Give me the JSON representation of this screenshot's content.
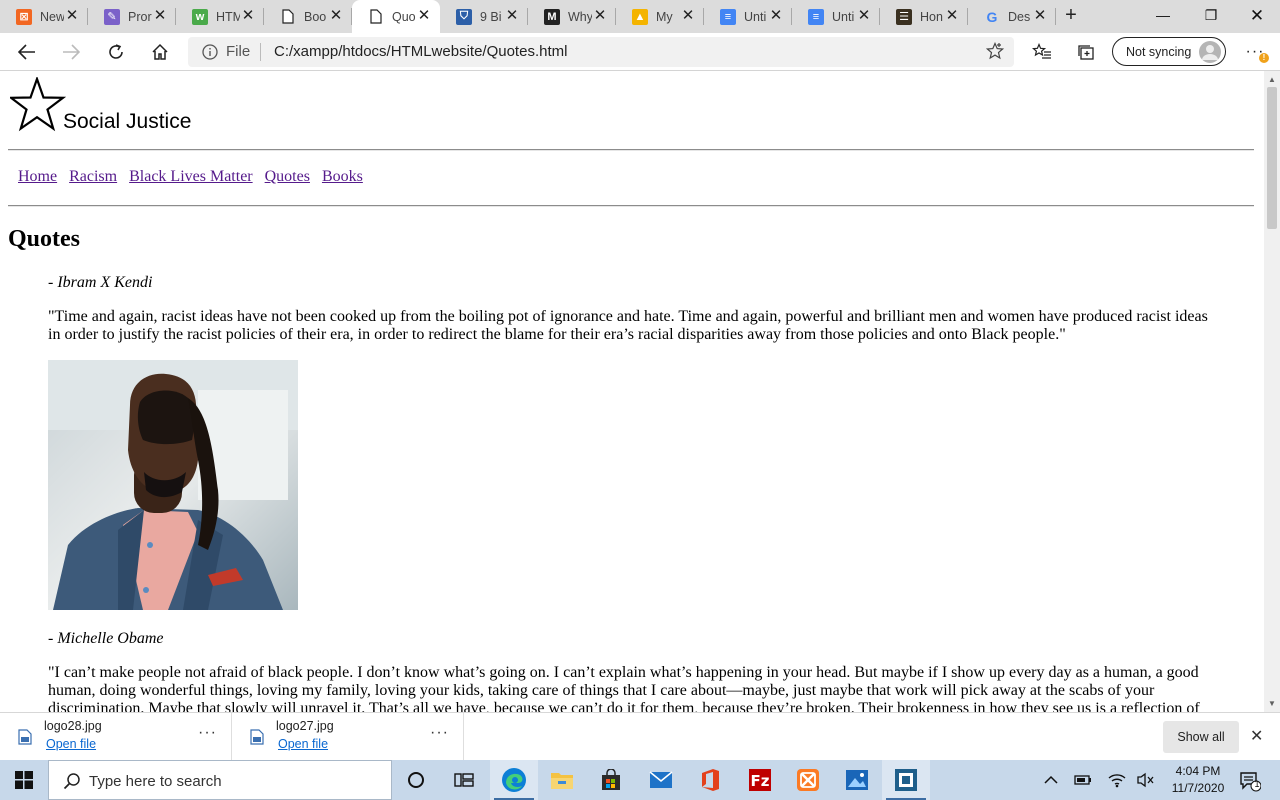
{
  "browser": {
    "tabs": [
      {
        "label": "New",
        "icon": "xampp-icon",
        "color": "#f26722",
        "glyph": "⊠"
      },
      {
        "label": "Pror",
        "icon": "pen-icon",
        "color": "#7b61c9",
        "glyph": "✎"
      },
      {
        "label": "HTM",
        "icon": "w3schools-icon",
        "color": "#4aaa4a",
        "glyph": "w"
      },
      {
        "label": "Boo",
        "icon": "page-icon",
        "color": "#ffffff",
        "glyph": ""
      },
      {
        "label": "Quo",
        "icon": "page-icon",
        "color": "#ffffff",
        "glyph": "",
        "active": true
      },
      {
        "label": "9 Bi",
        "icon": "shield-icon",
        "color": "#2c5fa8",
        "glyph": "⛉"
      },
      {
        "label": "Why",
        "icon": "medium-icon",
        "color": "#222222",
        "glyph": "M"
      },
      {
        "label": "My",
        "icon": "drive-icon",
        "color": "#f4b400",
        "glyph": "▲"
      },
      {
        "label": "Unti",
        "icon": "docs-icon",
        "color": "#4285f4",
        "glyph": "≡"
      },
      {
        "label": "Unti",
        "icon": "docs-icon",
        "color": "#4285f4",
        "glyph": "≡"
      },
      {
        "label": "Hon",
        "icon": "menu-icon",
        "color": "#3a3020",
        "glyph": "☰"
      },
      {
        "label": "Des",
        "icon": "google-icon",
        "color": "#ffffff",
        "glyph": "G"
      }
    ],
    "address": {
      "scheme_label": "File",
      "url": "C:/xampp/htdocs/HTMLwebsite/Quotes.html"
    },
    "sync_label": "Not syncing"
  },
  "page": {
    "site_title": "Social Justice",
    "nav": [
      "Home",
      "Racism",
      "Black Lives Matter",
      "Quotes",
      "Books"
    ],
    "heading": "Quotes",
    "quotes": [
      {
        "author": "- Ibram X Kendi",
        "text": "\"Time and again, racist ideas have not been cooked up from the boiling pot of ignorance and hate. Time and again, powerful and brilliant men and women have produced racist ideas in order to justify the racist policies of their era, in order to redirect the blame for their era’s racial disparities away from those policies and onto Black people.\""
      },
      {
        "author": "- Michelle Obame",
        "text": "\"I can’t make people not afraid of black people. I don’t know what’s going on. I can’t explain what’s happening in your head. But maybe if I show up every day as a human, a good human, doing wonderful things, loving my family, loving your kids, taking care of things that I care about—maybe, just maybe that work will pick away at the scabs of your discrimination. Maybe that slowly will unravel it. That’s all we have, because we can’t do it for them, because they’re broken. Their brokenness in how they see us is a reflection of"
      }
    ]
  },
  "downloads": {
    "items": [
      {
        "filename": "logo28.jpg",
        "action": "Open file"
      },
      {
        "filename": "logo27.jpg",
        "action": "Open file"
      }
    ],
    "show_all": "Show all"
  },
  "taskbar": {
    "search_placeholder": "Type here to search",
    "apps": [
      "cortana-icon",
      "task-view-icon",
      "edge-icon",
      "file-explorer-icon",
      "store-icon",
      "mail-icon",
      "office-icon",
      "filezilla-icon",
      "xampp-icon",
      "photos-icon",
      "app-icon"
    ],
    "time": "4:04 PM",
    "date": "11/7/2020",
    "notification_count": "1"
  }
}
